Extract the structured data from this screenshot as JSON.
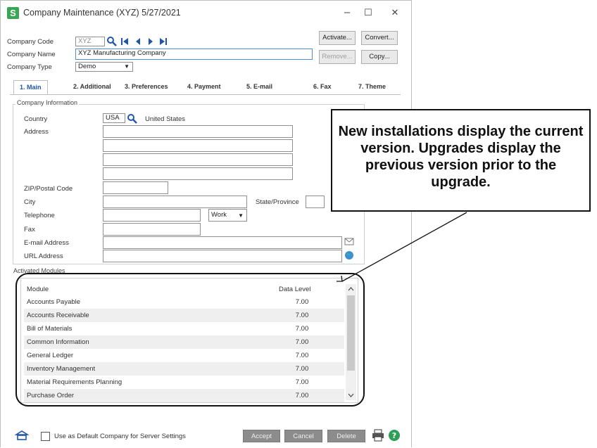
{
  "window": {
    "title": "Company Maintenance (XYZ) 5/27/2021",
    "app_icon": "S",
    "minimize": "–",
    "maximize": "☐",
    "close": "✕"
  },
  "header": {
    "company_code_label": "Company Code",
    "company_code_value": "XYZ",
    "company_name_label": "Company Name",
    "company_name_value": "XYZ Manufacturing Company",
    "company_type_label": "Company Type",
    "company_type_value": "Demo",
    "buttons": {
      "activate": "Activate...",
      "convert": "Convert...",
      "remove": "Remove...",
      "copy": "Copy..."
    }
  },
  "tabs": [
    "1. Main",
    "2. Additional",
    "3. Preferences",
    "4. Payment",
    "5. E-mail",
    "6. Fax",
    "7. Theme"
  ],
  "company_info": {
    "group_title": "Company Information",
    "country_label": "Country",
    "country_code": "USA",
    "country_name": "United States",
    "address_label": "Address",
    "zip_label": "ZIP/Postal Code",
    "city_label": "City",
    "state_label": "State/Province",
    "telephone_label": "Telephone",
    "phone_type": "Work",
    "fax_label": "Fax",
    "email_label": "E-mail Address",
    "url_label": "URL Address"
  },
  "modules": {
    "group_title": "Activated Modules",
    "col_module": "Module",
    "col_level": "Data Level",
    "rows": [
      {
        "module": "Accounts Payable",
        "level": "7.00"
      },
      {
        "module": "Accounts Receivable",
        "level": "7.00"
      },
      {
        "module": "Bill of Materials",
        "level": "7.00"
      },
      {
        "module": "Common Information",
        "level": "7.00"
      },
      {
        "module": "General Ledger",
        "level": "7.00"
      },
      {
        "module": "Inventory Management",
        "level": "7.00"
      },
      {
        "module": "Material Requirements Planning",
        "level": "7.00"
      },
      {
        "module": "Purchase Order",
        "level": "7.00"
      }
    ]
  },
  "footer": {
    "default_company_label": "Use as Default Company for Server Settings",
    "accept": "Accept",
    "cancel": "Cancel",
    "delete": "Delete"
  },
  "callout": {
    "text": "New installations display the current version. Upgrades display the previous version prior to the upgrade."
  },
  "icons": [
    "app-icon",
    "search-icon",
    "first-record-icon",
    "previous-record-icon",
    "next-record-icon",
    "last-record-icon",
    "email-icon",
    "globe-icon",
    "printer-icon",
    "help-icon",
    "company-icon"
  ]
}
